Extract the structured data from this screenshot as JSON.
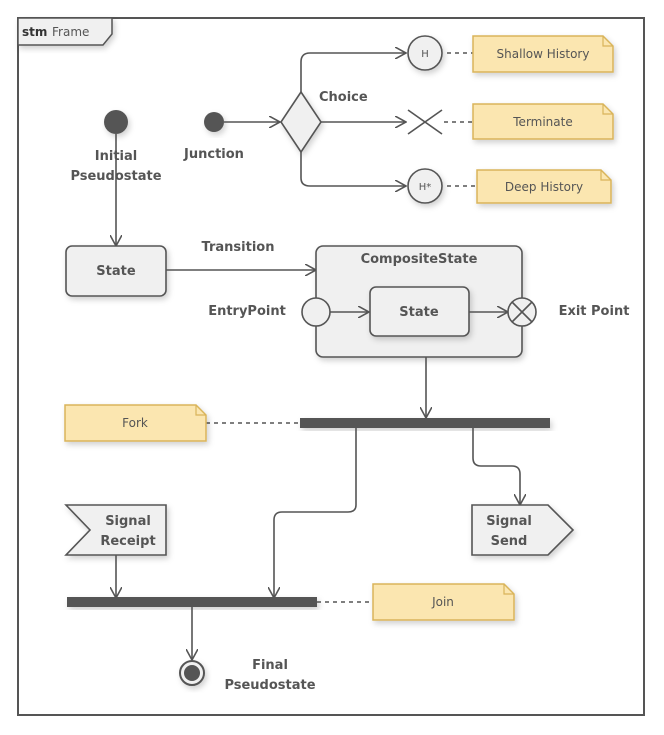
{
  "frame": {
    "keyword": "stm",
    "name": "Frame"
  },
  "colors": {
    "stroke": "#555555",
    "shape_fill": "#f0f0f0",
    "note_fill": "#fbe6b0",
    "note_stroke": "#d9b45a",
    "bar": "#555555"
  },
  "elements": {
    "initial": {
      "label_line1": "Initial",
      "label_line2": "Pseudostate"
    },
    "junction": {
      "label": "Junction"
    },
    "choice": {
      "label": "Choice"
    },
    "shallow_history": {
      "symbol": "H",
      "note": "Shallow History"
    },
    "terminate": {
      "note": "Terminate"
    },
    "deep_history": {
      "symbol": "H*",
      "note": "Deep History"
    },
    "state": {
      "label": "State"
    },
    "transition": {
      "label": "Transition"
    },
    "composite": {
      "label": "CompositeState",
      "inner_state": "State"
    },
    "entry_point": {
      "label": "EntryPoint"
    },
    "exit_point": {
      "label": "Exit Point"
    },
    "fork": {
      "note": "Fork"
    },
    "join": {
      "note": "Join"
    },
    "signal_receipt": {
      "line1": "Signal",
      "line2": "Receipt"
    },
    "signal_send": {
      "line1": "Signal",
      "line2": "Send"
    },
    "final": {
      "label_line1": "Final",
      "label_line2": "Pseudostate"
    }
  }
}
